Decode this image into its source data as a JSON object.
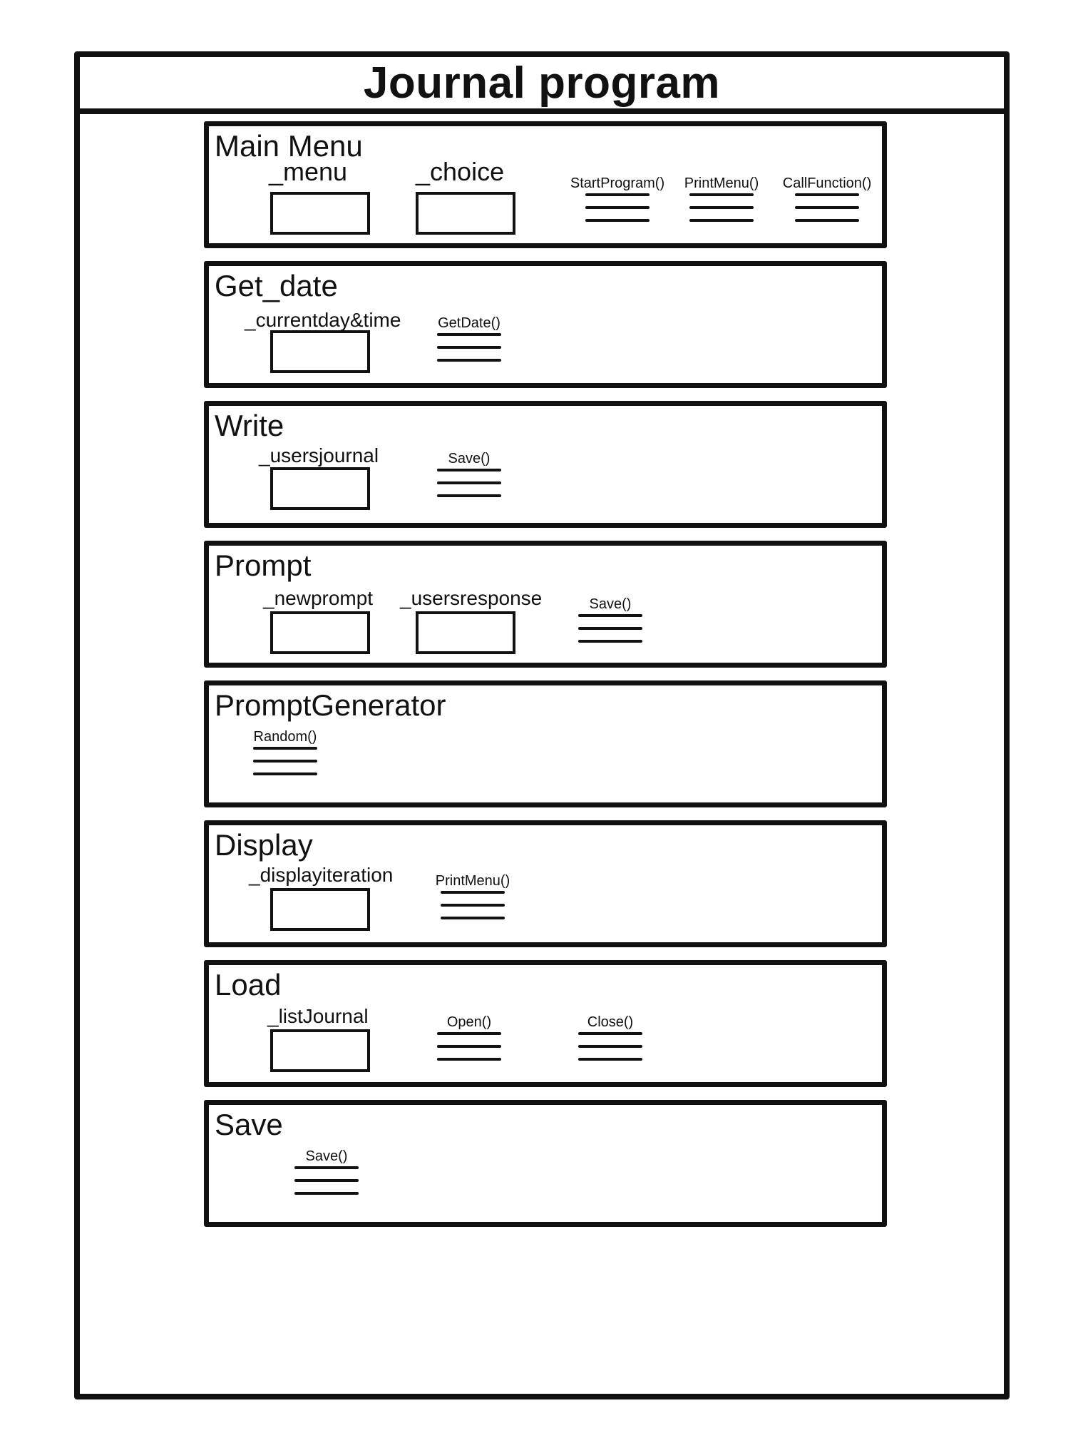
{
  "title": "Journal program",
  "panels": [
    {
      "title": "Main Menu",
      "fields": [
        "_menu",
        "_choice"
      ],
      "methods": [
        "StartProgram()",
        "PrintMenu()",
        "CallFunction()"
      ]
    },
    {
      "title": "Get_date",
      "fields": [
        "_currentday&time"
      ],
      "methods": [
        "GetDate()"
      ]
    },
    {
      "title": "Write",
      "fields": [
        "_usersjournal"
      ],
      "methods": [
        "Save()"
      ]
    },
    {
      "title": "Prompt",
      "fields": [
        "_newprompt",
        "_usersresponse"
      ],
      "methods": [
        "Save()"
      ]
    },
    {
      "title": "PromptGenerator",
      "fields": [],
      "methods": [
        "Random()"
      ]
    },
    {
      "title": "Display",
      "fields": [
        "_displayiteration"
      ],
      "methods": [
        "PrintMenu()"
      ]
    },
    {
      "title": "Load",
      "fields": [
        "_listJournal"
      ],
      "methods": [
        "Open()",
        "Close()"
      ]
    },
    {
      "title": "Save",
      "fields": [],
      "methods": [
        "Save()"
      ]
    }
  ]
}
